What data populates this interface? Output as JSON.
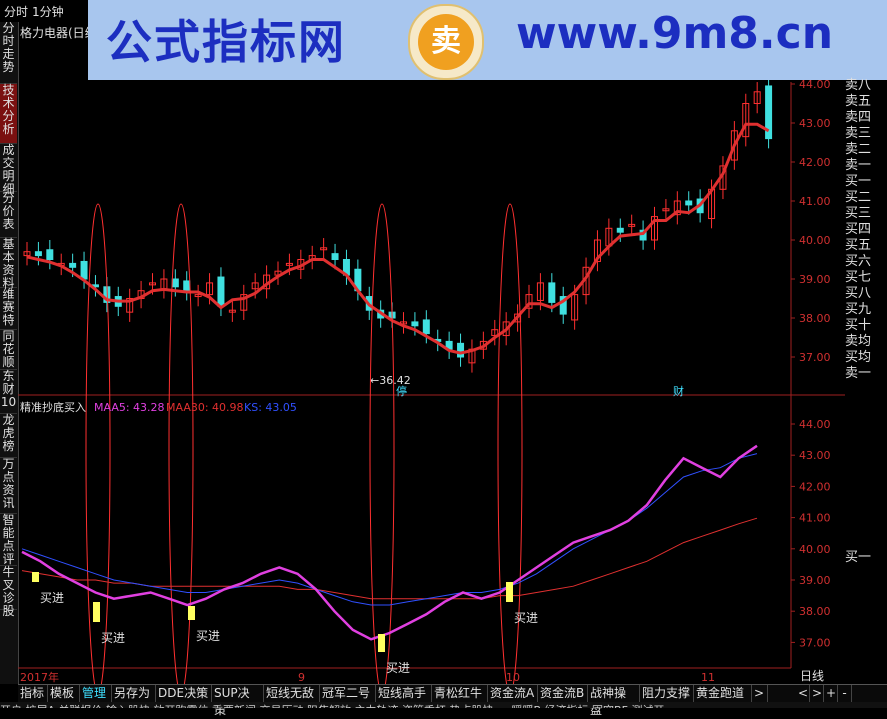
{
  "topbar": {
    "timeshare": "分时",
    "minute1": "1分钟"
  },
  "stock": {
    "name": "格力电器(日线)"
  },
  "sidebar": [
    {
      "label": "分时走势",
      "active": false
    },
    {
      "label": "技术分析",
      "active": true
    },
    {
      "label": "成交明细",
      "active": false
    },
    {
      "label": "分价表",
      "active": false
    },
    {
      "label": "基本资料",
      "active": false
    },
    {
      "label": "维赛特",
      "active": false
    },
    {
      "label": "同花顺",
      "active": false
    },
    {
      "label": "东财10",
      "active": false
    },
    {
      "label": "龙虎榜",
      "active": false
    },
    {
      "label": "万点资讯",
      "active": false
    },
    {
      "label": "智能点评",
      "active": false
    },
    {
      "label": "牛叉诊股",
      "active": false
    }
  ],
  "banner": {
    "title": "公式指标网",
    "logo_char": "卖",
    "url": "www.9m8.cn"
  },
  "order_book": [
    "卖八",
    "卖五",
    "卖四",
    "卖三",
    "卖二",
    "卖一",
    "买一",
    "买二",
    "买三",
    "买四",
    "买五",
    "买六",
    "买七",
    "买八",
    "买九",
    "买十",
    "卖均",
    "买均",
    "卖一"
  ],
  "order_book_low": "买一",
  "main_axis": [
    "44.00",
    "43.00",
    "42.00",
    "41.00",
    "40.00",
    "39.00",
    "38.00",
    "37.00"
  ],
  "sub_axis": [
    "44.00",
    "43.00",
    "42.00",
    "41.00",
    "40.00",
    "39.00",
    "38.00",
    "37.00"
  ],
  "low_label": "←36.42",
  "marker_stop": "停",
  "marker_cai": "财",
  "indicator": {
    "name": "精准抄底买入",
    "maa5": "MAA5: 43.28",
    "maa30": "MAA30: 40.98",
    "ks": "KS: 43.05",
    "maa5_color": "#e040e0",
    "maa30_color": "#e03030",
    "ks_color": "#3050ff"
  },
  "buy_label": "买进",
  "date_axis": [
    "2017年",
    "9",
    "10",
    "11"
  ],
  "period": "日线",
  "bottom_tabs": [
    {
      "label": "指标",
      "active": false
    },
    {
      "label": "模板",
      "active": false
    },
    {
      "label": "管理",
      "active": true
    },
    {
      "label": "另存为",
      "active": false
    },
    {
      "label": "DDE决策",
      "active": false
    },
    {
      "label": "SUP决策",
      "active": false
    },
    {
      "label": "短线无敌",
      "active": false
    },
    {
      "label": "冠军二号",
      "active": false
    },
    {
      "label": "短线高手",
      "active": false
    },
    {
      "label": "青松红牛",
      "active": false
    },
    {
      "label": "资金流A",
      "active": false
    },
    {
      "label": "资金流B",
      "active": false
    },
    {
      "label": "战神操盘",
      "active": false
    },
    {
      "label": "阻力支撑",
      "active": false
    },
    {
      "label": "黄金跑道",
      "active": false
    },
    {
      "label": ">",
      "active": false
    }
  ],
  "nav_buttons": [
    "<",
    ">",
    "+",
    "-"
  ],
  "bottom_row": "开户  扩展A  关联报价  输入股快  放开购零位  重要新闻  交易历动  阻焦解放  主力轨迹  资管香杠  热点股快  一  瞬暖B  经济指标  围穷BF  测试开"
}
